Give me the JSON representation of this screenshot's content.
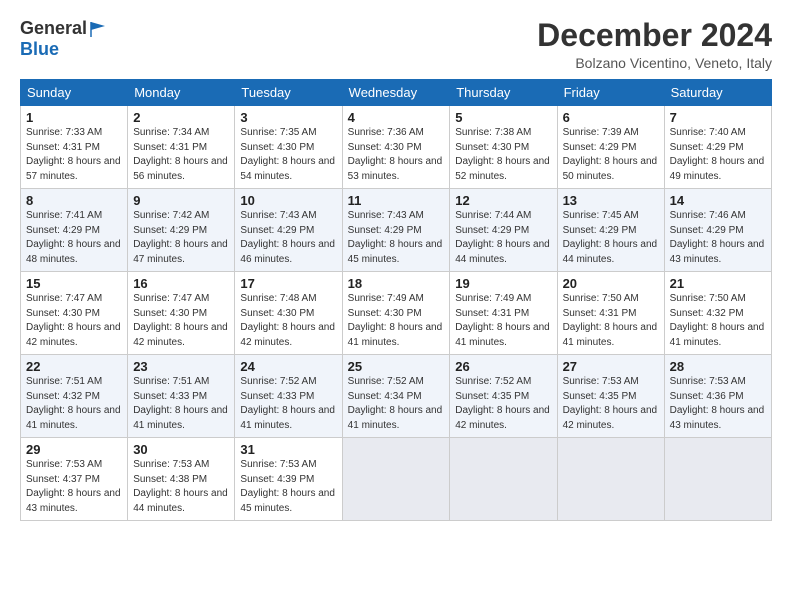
{
  "logo": {
    "general": "General",
    "blue": "Blue"
  },
  "header": {
    "month_year": "December 2024",
    "location": "Bolzano Vicentino, Veneto, Italy"
  },
  "weekdays": [
    "Sunday",
    "Monday",
    "Tuesday",
    "Wednesday",
    "Thursday",
    "Friday",
    "Saturday"
  ],
  "weeks": [
    [
      {
        "day": "1",
        "sunrise": "Sunrise: 7:33 AM",
        "sunset": "Sunset: 4:31 PM",
        "daylight": "Daylight: 8 hours and 57 minutes."
      },
      {
        "day": "2",
        "sunrise": "Sunrise: 7:34 AM",
        "sunset": "Sunset: 4:31 PM",
        "daylight": "Daylight: 8 hours and 56 minutes."
      },
      {
        "day": "3",
        "sunrise": "Sunrise: 7:35 AM",
        "sunset": "Sunset: 4:30 PM",
        "daylight": "Daylight: 8 hours and 54 minutes."
      },
      {
        "day": "4",
        "sunrise": "Sunrise: 7:36 AM",
        "sunset": "Sunset: 4:30 PM",
        "daylight": "Daylight: 8 hours and 53 minutes."
      },
      {
        "day": "5",
        "sunrise": "Sunrise: 7:38 AM",
        "sunset": "Sunset: 4:30 PM",
        "daylight": "Daylight: 8 hours and 52 minutes."
      },
      {
        "day": "6",
        "sunrise": "Sunrise: 7:39 AM",
        "sunset": "Sunset: 4:29 PM",
        "daylight": "Daylight: 8 hours and 50 minutes."
      },
      {
        "day": "7",
        "sunrise": "Sunrise: 7:40 AM",
        "sunset": "Sunset: 4:29 PM",
        "daylight": "Daylight: 8 hours and 49 minutes."
      }
    ],
    [
      {
        "day": "8",
        "sunrise": "Sunrise: 7:41 AM",
        "sunset": "Sunset: 4:29 PM",
        "daylight": "Daylight: 8 hours and 48 minutes."
      },
      {
        "day": "9",
        "sunrise": "Sunrise: 7:42 AM",
        "sunset": "Sunset: 4:29 PM",
        "daylight": "Daylight: 8 hours and 47 minutes."
      },
      {
        "day": "10",
        "sunrise": "Sunrise: 7:43 AM",
        "sunset": "Sunset: 4:29 PM",
        "daylight": "Daylight: 8 hours and 46 minutes."
      },
      {
        "day": "11",
        "sunrise": "Sunrise: 7:43 AM",
        "sunset": "Sunset: 4:29 PM",
        "daylight": "Daylight: 8 hours and 45 minutes."
      },
      {
        "day": "12",
        "sunrise": "Sunrise: 7:44 AM",
        "sunset": "Sunset: 4:29 PM",
        "daylight": "Daylight: 8 hours and 44 minutes."
      },
      {
        "day": "13",
        "sunrise": "Sunrise: 7:45 AM",
        "sunset": "Sunset: 4:29 PM",
        "daylight": "Daylight: 8 hours and 44 minutes."
      },
      {
        "day": "14",
        "sunrise": "Sunrise: 7:46 AM",
        "sunset": "Sunset: 4:29 PM",
        "daylight": "Daylight: 8 hours and 43 minutes."
      }
    ],
    [
      {
        "day": "15",
        "sunrise": "Sunrise: 7:47 AM",
        "sunset": "Sunset: 4:30 PM",
        "daylight": "Daylight: 8 hours and 42 minutes."
      },
      {
        "day": "16",
        "sunrise": "Sunrise: 7:47 AM",
        "sunset": "Sunset: 4:30 PM",
        "daylight": "Daylight: 8 hours and 42 minutes."
      },
      {
        "day": "17",
        "sunrise": "Sunrise: 7:48 AM",
        "sunset": "Sunset: 4:30 PM",
        "daylight": "Daylight: 8 hours and 42 minutes."
      },
      {
        "day": "18",
        "sunrise": "Sunrise: 7:49 AM",
        "sunset": "Sunset: 4:30 PM",
        "daylight": "Daylight: 8 hours and 41 minutes."
      },
      {
        "day": "19",
        "sunrise": "Sunrise: 7:49 AM",
        "sunset": "Sunset: 4:31 PM",
        "daylight": "Daylight: 8 hours and 41 minutes."
      },
      {
        "day": "20",
        "sunrise": "Sunrise: 7:50 AM",
        "sunset": "Sunset: 4:31 PM",
        "daylight": "Daylight: 8 hours and 41 minutes."
      },
      {
        "day": "21",
        "sunrise": "Sunrise: 7:50 AM",
        "sunset": "Sunset: 4:32 PM",
        "daylight": "Daylight: 8 hours and 41 minutes."
      }
    ],
    [
      {
        "day": "22",
        "sunrise": "Sunrise: 7:51 AM",
        "sunset": "Sunset: 4:32 PM",
        "daylight": "Daylight: 8 hours and 41 minutes."
      },
      {
        "day": "23",
        "sunrise": "Sunrise: 7:51 AM",
        "sunset": "Sunset: 4:33 PM",
        "daylight": "Daylight: 8 hours and 41 minutes."
      },
      {
        "day": "24",
        "sunrise": "Sunrise: 7:52 AM",
        "sunset": "Sunset: 4:33 PM",
        "daylight": "Daylight: 8 hours and 41 minutes."
      },
      {
        "day": "25",
        "sunrise": "Sunrise: 7:52 AM",
        "sunset": "Sunset: 4:34 PM",
        "daylight": "Daylight: 8 hours and 41 minutes."
      },
      {
        "day": "26",
        "sunrise": "Sunrise: 7:52 AM",
        "sunset": "Sunset: 4:35 PM",
        "daylight": "Daylight: 8 hours and 42 minutes."
      },
      {
        "day": "27",
        "sunrise": "Sunrise: 7:53 AM",
        "sunset": "Sunset: 4:35 PM",
        "daylight": "Daylight: 8 hours and 42 minutes."
      },
      {
        "day": "28",
        "sunrise": "Sunrise: 7:53 AM",
        "sunset": "Sunset: 4:36 PM",
        "daylight": "Daylight: 8 hours and 43 minutes."
      }
    ],
    [
      {
        "day": "29",
        "sunrise": "Sunrise: 7:53 AM",
        "sunset": "Sunset: 4:37 PM",
        "daylight": "Daylight: 8 hours and 43 minutes."
      },
      {
        "day": "30",
        "sunrise": "Sunrise: 7:53 AM",
        "sunset": "Sunset: 4:38 PM",
        "daylight": "Daylight: 8 hours and 44 minutes."
      },
      {
        "day": "31",
        "sunrise": "Sunrise: 7:53 AM",
        "sunset": "Sunset: 4:39 PM",
        "daylight": "Daylight: 8 hours and 45 minutes."
      },
      null,
      null,
      null,
      null
    ]
  ]
}
